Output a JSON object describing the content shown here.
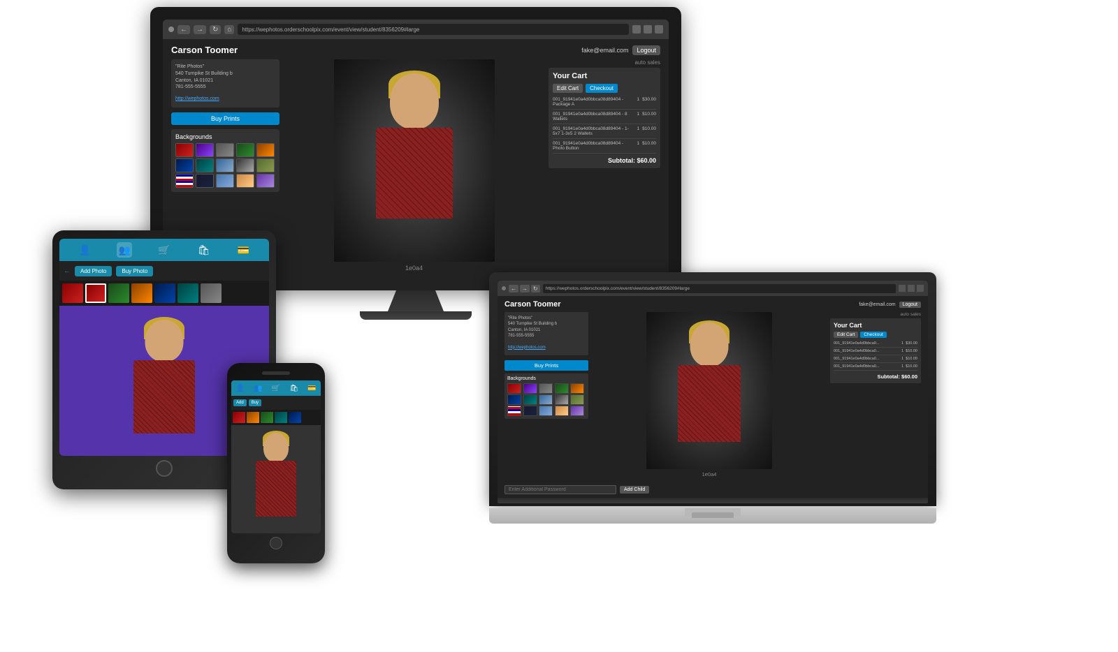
{
  "monitor": {
    "url": "https://wephotos.orderschoolpix.com/event/view/student/8356209#large",
    "student_name": "Carson Toomer",
    "email": "fake@email.com",
    "logout": "Logout",
    "studio": {
      "name": "\"Rite Photos\"",
      "address": "540 Turnpike St Building b",
      "city": "Canton, IA 01021",
      "phone": "781-555-5555",
      "website": "http://wephotos.com"
    },
    "buy_prints": "Buy Prints",
    "backgrounds_title": "Backgrounds",
    "photo_label": "1e0a4",
    "auto_sales": "auto sales",
    "cart": {
      "title": "Your Cart",
      "edit_cart": "Edit Cart",
      "checkout": "Checkout",
      "items": [
        {
          "desc": "001_91941e0a4d0bbca08d89404 - Package A",
          "qty": "1",
          "price": "$30.00"
        },
        {
          "desc": "001_91941e0a4d0bbca08d89404 - 8 Wallets",
          "qty": "1",
          "price": "$10.00"
        },
        {
          "desc": "001_91941e0a4d0bbca08d89404 - 1-5x7 1-3x5 2 Wallets",
          "qty": "1",
          "price": "$10.00"
        },
        {
          "desc": "001_91941e0a4d0bbca08d89404 - Photo Button",
          "qty": "1",
          "price": "$10.00"
        }
      ],
      "subtotal": "Subtotal: $60.00"
    }
  },
  "tablet": {
    "add_photo": "Add Photo",
    "buy_photo": "Buy Photo"
  },
  "phone": {
    "add_photo": "Add",
    "buy_photo": "Buy"
  },
  "laptop": {
    "url": "https://wephotos.orderschoolpix.com/event/view/student/8356209#large",
    "student_name": "Carson Toomer",
    "email": "fake@email.com",
    "logout": "Logout",
    "studio": {
      "name": "\"Rite Photos\"",
      "address": "540 Turnpike St Building b",
      "city": "Canton, IA 01021",
      "phone": "781-555-5555",
      "website": "http://wephotos.com"
    },
    "buy_prints": "Buy Prints",
    "backgrounds_title": "Backgrounds",
    "photo_label": "1e0a4",
    "auto_sales": "auto sales",
    "cart": {
      "title": "Your Cart",
      "edit_cart": "Edit Cart",
      "checkout": "Checkout",
      "items": [
        {
          "desc": "001_91941e0a4d0bbca0...",
          "qty": "1",
          "price": "$30.00"
        },
        {
          "desc": "001_91941e0a4d0bbca0...",
          "qty": "1",
          "price": "$10.00"
        },
        {
          "desc": "001_91941e0a4d0bbca0...",
          "qty": "1",
          "price": "$10.00"
        },
        {
          "desc": "001_91941e0a4d0bbca0...",
          "qty": "1",
          "price": "$10.00"
        }
      ],
      "subtotal": "Subtotal: $60.00"
    },
    "footer_placeholder": "Enter Additional Password",
    "add_child": "Add Child"
  }
}
